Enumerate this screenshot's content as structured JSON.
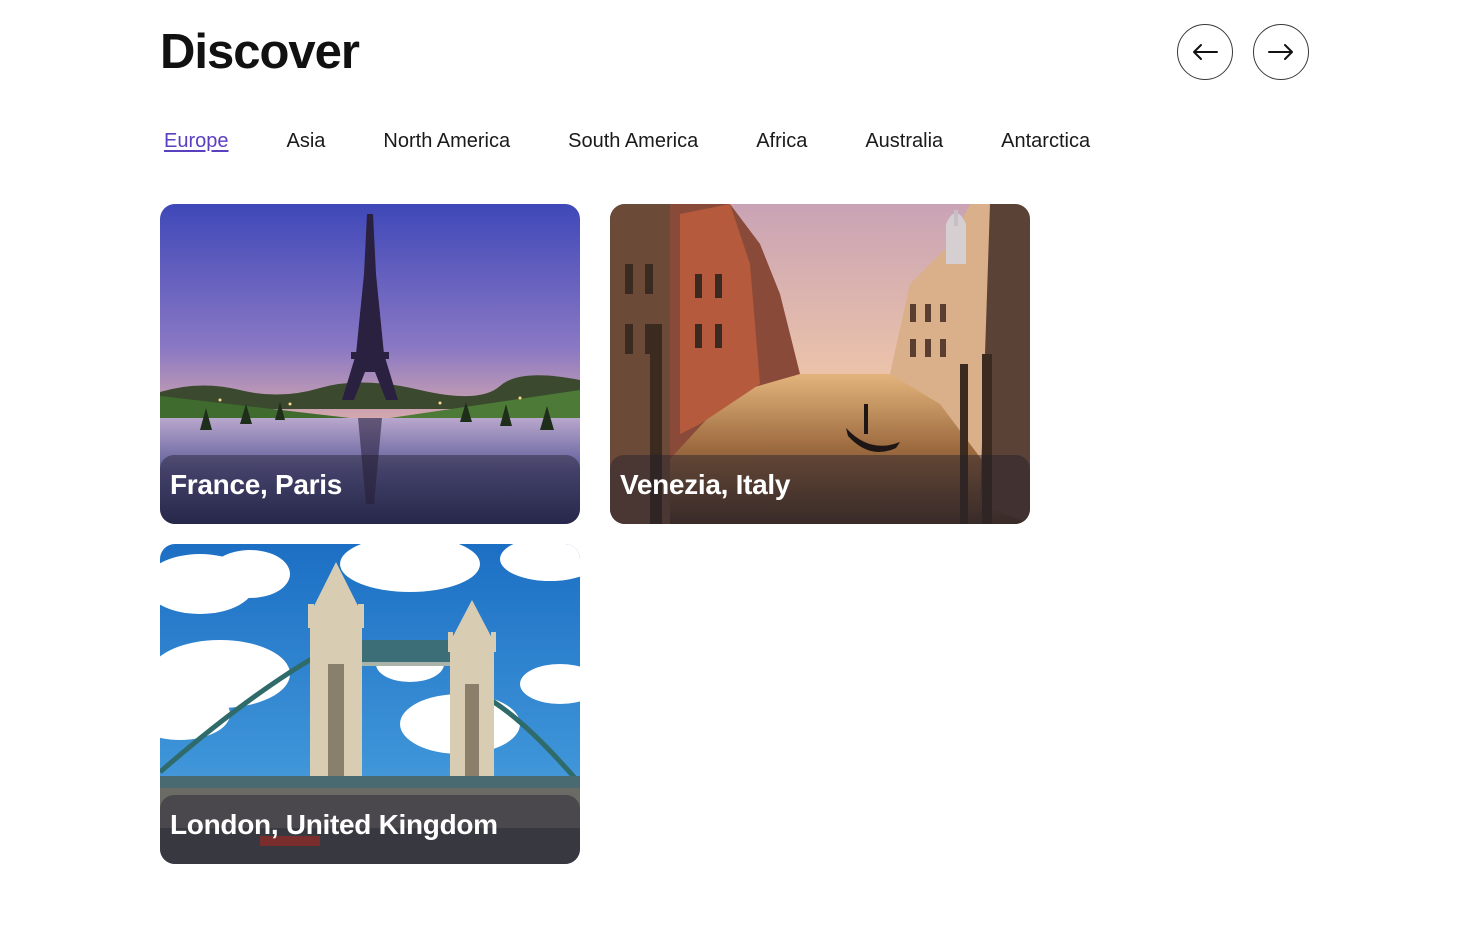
{
  "header": {
    "title": "Discover",
    "prev_icon": "arrow-left-icon",
    "next_icon": "arrow-right-icon"
  },
  "tabs": [
    {
      "label": "Europe",
      "active": true
    },
    {
      "label": "Asia",
      "active": false
    },
    {
      "label": "North America",
      "active": false
    },
    {
      "label": "South America",
      "active": false
    },
    {
      "label": "Africa",
      "active": false
    },
    {
      "label": "Australia",
      "active": false
    },
    {
      "label": "Antarctica",
      "active": false
    }
  ],
  "destinations": [
    {
      "caption": "France, Paris",
      "image": "eiffel-tower-sunset"
    },
    {
      "caption": "Venezia, Italy",
      "image": "venice-canal-gondola"
    },
    {
      "caption": "London, United Kingdom",
      "image": "tower-bridge-blue-sky"
    }
  ],
  "colors": {
    "accent": "#5a3fc0",
    "text": "#111111",
    "background": "#ffffff"
  }
}
